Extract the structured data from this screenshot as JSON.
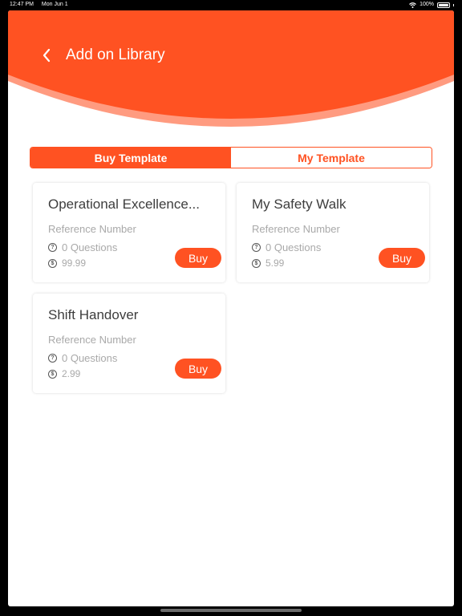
{
  "status_bar": {
    "time": "12:47 PM",
    "date": "Mon Jun 1",
    "battery": "100%"
  },
  "header": {
    "title": "Add on Library",
    "back_icon": "chevron-left-icon"
  },
  "segments": {
    "buy": "Buy Template",
    "mine": "My Template",
    "active": "buy"
  },
  "cards": [
    {
      "title": "Operational Excellence...",
      "reference": "Reference Number",
      "questions": "0 Questions",
      "price": "99.99",
      "buy_label": "Buy"
    },
    {
      "title": "My Safety Walk",
      "reference": "Reference Number",
      "questions": "0 Questions",
      "price": "5.99",
      "buy_label": "Buy"
    },
    {
      "title": "Shift Handover",
      "reference": "Reference Number",
      "questions": "0 Questions",
      "price": "2.99",
      "buy_label": "Buy"
    }
  ],
  "colors": {
    "accent": "#ff5222",
    "accent_light": "#ff9b80",
    "text_dark": "#3d3d3d",
    "text_muted": "#a9a9a9"
  }
}
